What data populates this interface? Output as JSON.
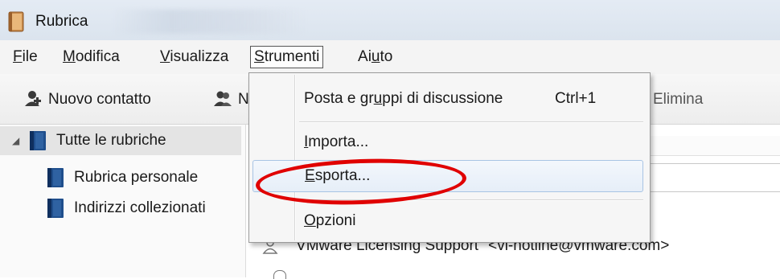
{
  "window": {
    "title": "Rubrica"
  },
  "menubar": {
    "items": [
      {
        "label": "File",
        "accel_index": 0
      },
      {
        "label": "Modifica",
        "accel_index": 0
      },
      {
        "label": "Visualizza",
        "accel_index": 0
      },
      {
        "label": "Strumenti",
        "accel_index": 0
      },
      {
        "label": "Aiuto",
        "accel_index": 2
      }
    ]
  },
  "toolbar": {
    "new_contact_label": "Nuovo contatto",
    "second_button_partial": "N",
    "delete_label": "Elimina"
  },
  "sidebar": {
    "root": "Tutte le rubriche",
    "items": [
      {
        "label": "Rubrica personale"
      },
      {
        "label": "Indirizzi collezionati"
      }
    ]
  },
  "contacts": {
    "row1": "\"VMware Licensing Support\" <vi-hotline@vmware.com>"
  },
  "dropdown": {
    "items": [
      {
        "label": "Posta e gruppi di discussione",
        "accel_index": 10,
        "shortcut": "Ctrl+1"
      },
      {
        "label": "Importa...",
        "accel_index": 0
      },
      {
        "label": "Esporta...",
        "accel_index": 0
      },
      {
        "label": "Opzioni",
        "accel_index": 0
      }
    ]
  },
  "colors": {
    "highlight_ring": "#e00000",
    "hover_border": "#a8c4e4",
    "book_blue": "#1f4e8c"
  }
}
